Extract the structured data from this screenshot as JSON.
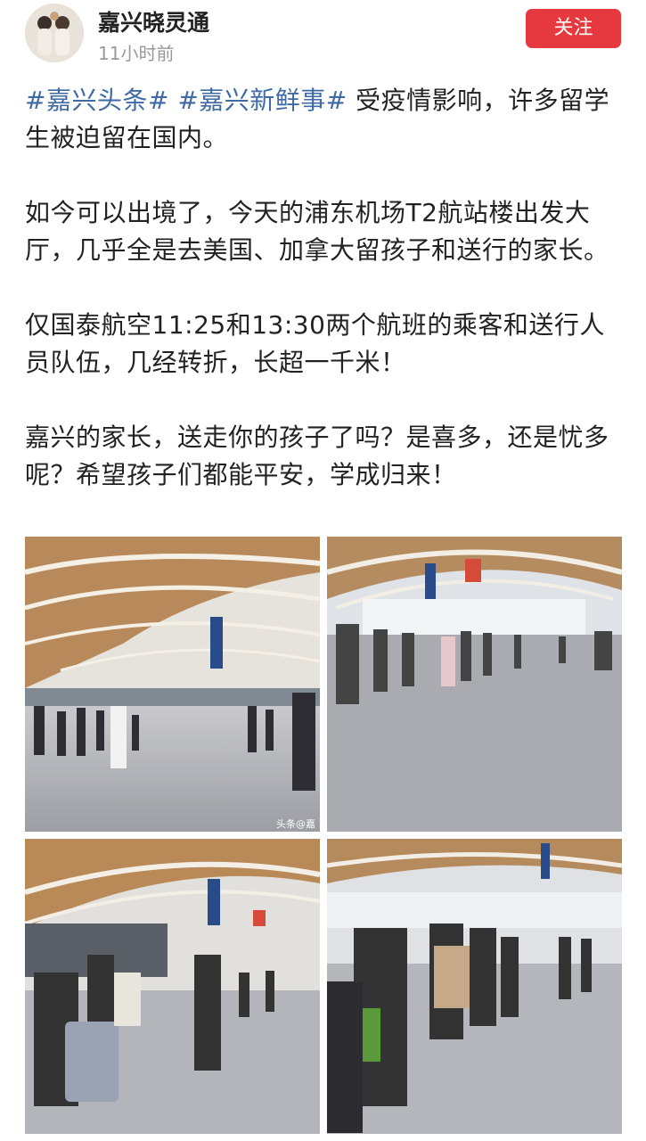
{
  "header": {
    "author_name": "嘉兴晓灵通",
    "post_time": "11小时前",
    "follow_label": "关注"
  },
  "post": {
    "hashtag1": "#嘉兴头条#",
    "hashtag2": "#嘉兴新鲜事#",
    "para1_rest": " 受疫情影响，许多留学生被迫留在国内。",
    "para2": "如今可以出境了，今天的浦东机场T2航站楼出发大厅，几乎全是去美国、加拿大留孩子和送行的家长。",
    "para3": "仅国泰航空11:25和13:30两个航班的乘客和送行人员队伍，几经转折，长超一千米！",
    "para4": "嘉兴的家长，送走你的孩子了吗？是喜多，还是忧多呢？希望孩子们都能平安，学成归来！"
  },
  "photos": {
    "watermark": "头条@嘉"
  },
  "colors": {
    "accent": "#e5393f",
    "hashtag": "#3f6aa6"
  }
}
